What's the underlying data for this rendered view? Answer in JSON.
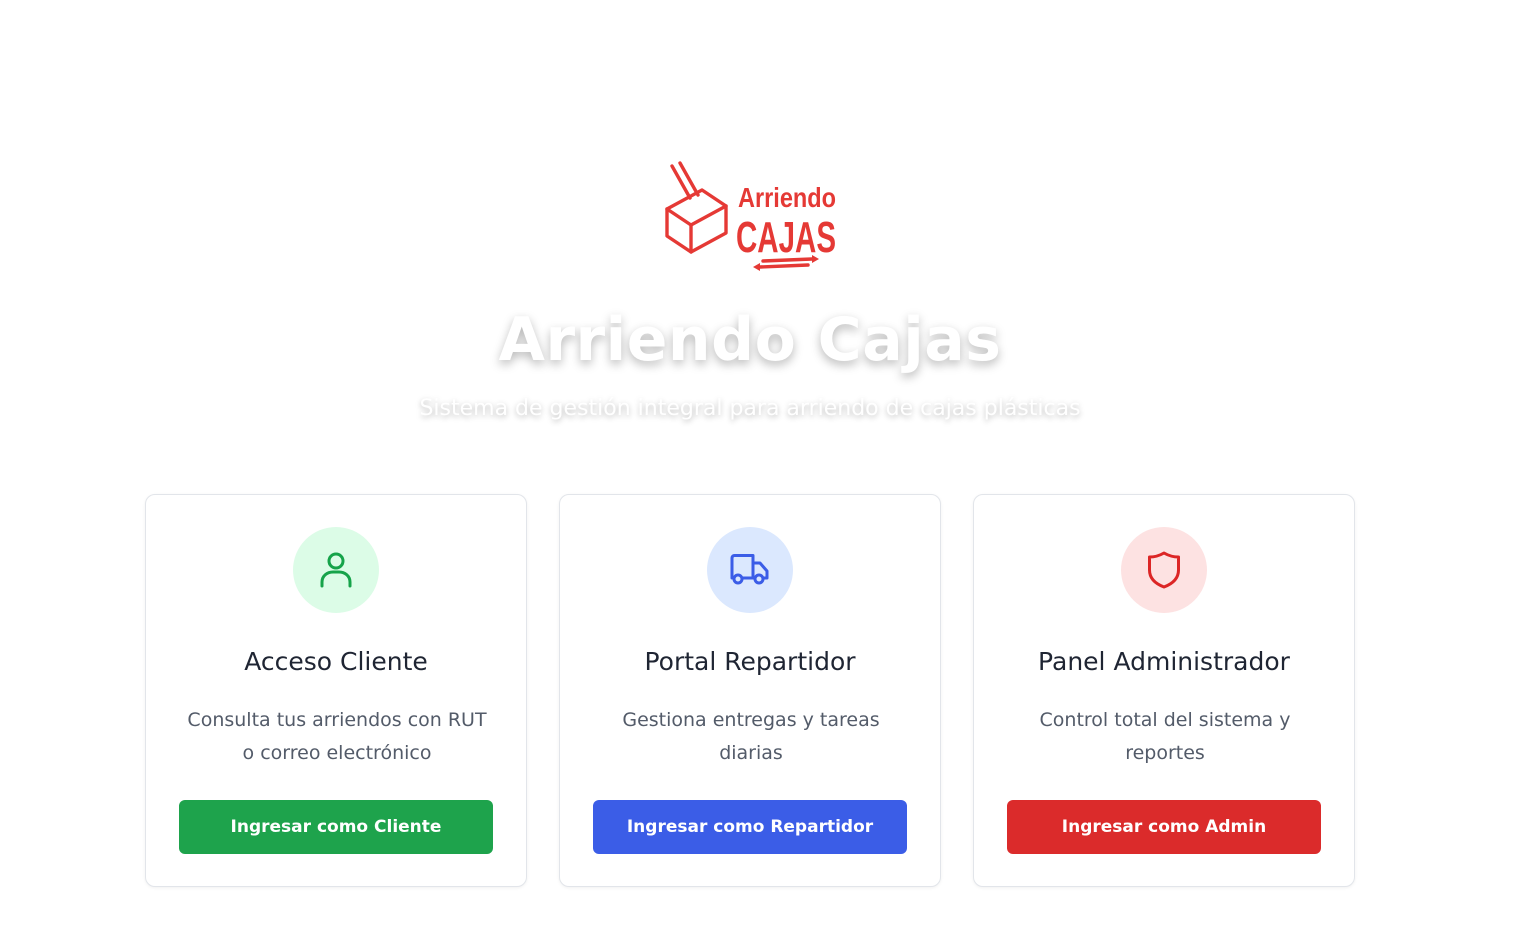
{
  "logo": {
    "line1": "Arriendo",
    "line2": "CAJAS",
    "color": "#e53935"
  },
  "hero": {
    "title": "Arriendo Cajas",
    "subtitle": "Sistema de gestión integral para arriendo de cajas plásticas"
  },
  "cards": [
    {
      "icon": "user-icon",
      "title": "Acceso Cliente",
      "description": "Consulta tus arriendos con RUT o correo electrónico",
      "button_label": "Ingresar como Cliente",
      "accent": "#1ea34c",
      "icon_bg": "#dcfce7",
      "icon_color": "#16a34a"
    },
    {
      "icon": "truck-icon",
      "title": "Portal Repartidor",
      "description": "Gestiona entregas y tareas diarias",
      "button_label": "Ingresar como Repartidor",
      "accent": "#3b5de7",
      "icon_bg": "#dbe8fe",
      "icon_color": "#3b5de7"
    },
    {
      "icon": "shield-icon",
      "title": "Panel Administrador",
      "description": "Control total del sistema y reportes",
      "button_label": "Ingresar como Admin",
      "accent": "#db2b2b",
      "icon_bg": "#fde2e2",
      "icon_color": "#dc2626"
    }
  ]
}
